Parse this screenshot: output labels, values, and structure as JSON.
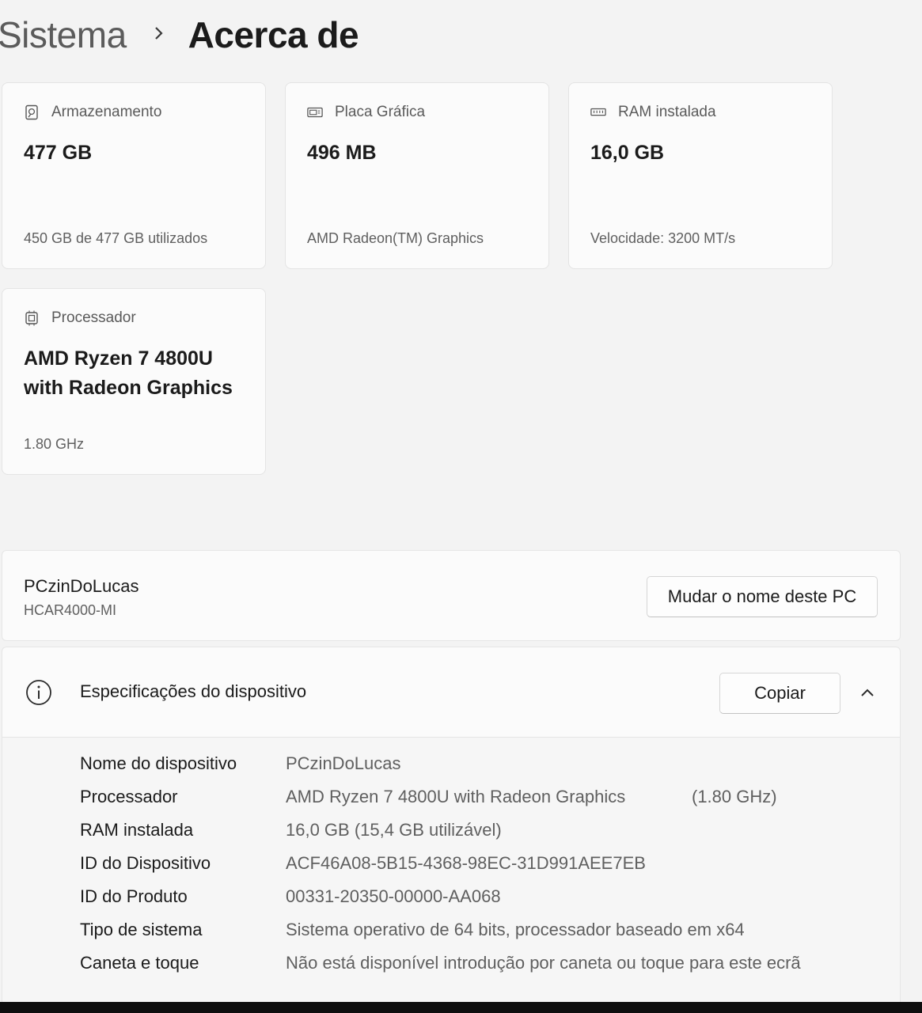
{
  "breadcrumb": {
    "parent": "Sistema",
    "current": "Acerca de"
  },
  "cards": [
    {
      "icon": "storage-icon",
      "title": "Armazenamento",
      "value": "477 GB",
      "sub": "450 GB de 477 GB utilizados"
    },
    {
      "icon": "graphics-card-icon",
      "title": "Placa Gráfica",
      "value": "496 MB",
      "sub": "AMD Radeon(TM) Graphics"
    },
    {
      "icon": "ram-icon",
      "title": "RAM instalada",
      "value": "16,0 GB",
      "sub": "Velocidade: 3200 MT/s"
    },
    {
      "icon": "processor-icon",
      "title": "Processador",
      "value": "AMD Ryzen 7 4800U with Radeon Graphics",
      "sub": "1.80 GHz"
    }
  ],
  "pc": {
    "name": "PCzinDoLucas",
    "model": "HCAR4000-MI",
    "rename_label": "Mudar o nome deste PC"
  },
  "specs": {
    "title": "Especificações do dispositivo",
    "copy_label": "Copiar",
    "rows": [
      {
        "label": "Nome do dispositivo",
        "value": "PCzinDoLucas",
        "extra": ""
      },
      {
        "label": "Processador",
        "value": "AMD Ryzen 7 4800U with Radeon Graphics",
        "extra": "(1.80 GHz)"
      },
      {
        "label": "RAM instalada",
        "value": "16,0 GB (15,4 GB utilizável)",
        "extra": ""
      },
      {
        "label": "ID do Dispositivo",
        "value": "ACF46A08-5B15-4368-98EC-31D991AEE7EB",
        "extra": ""
      },
      {
        "label": "ID do Produto",
        "value": "00331-20350-00000-AA068",
        "extra": ""
      },
      {
        "label": "Tipo de sistema",
        "value": "Sistema operativo de 64 bits, processador baseado em x64",
        "extra": ""
      },
      {
        "label": "Caneta e toque",
        "value": "Não está disponível introdução por caneta ou toque para este ecrã",
        "extra": ""
      }
    ]
  }
}
